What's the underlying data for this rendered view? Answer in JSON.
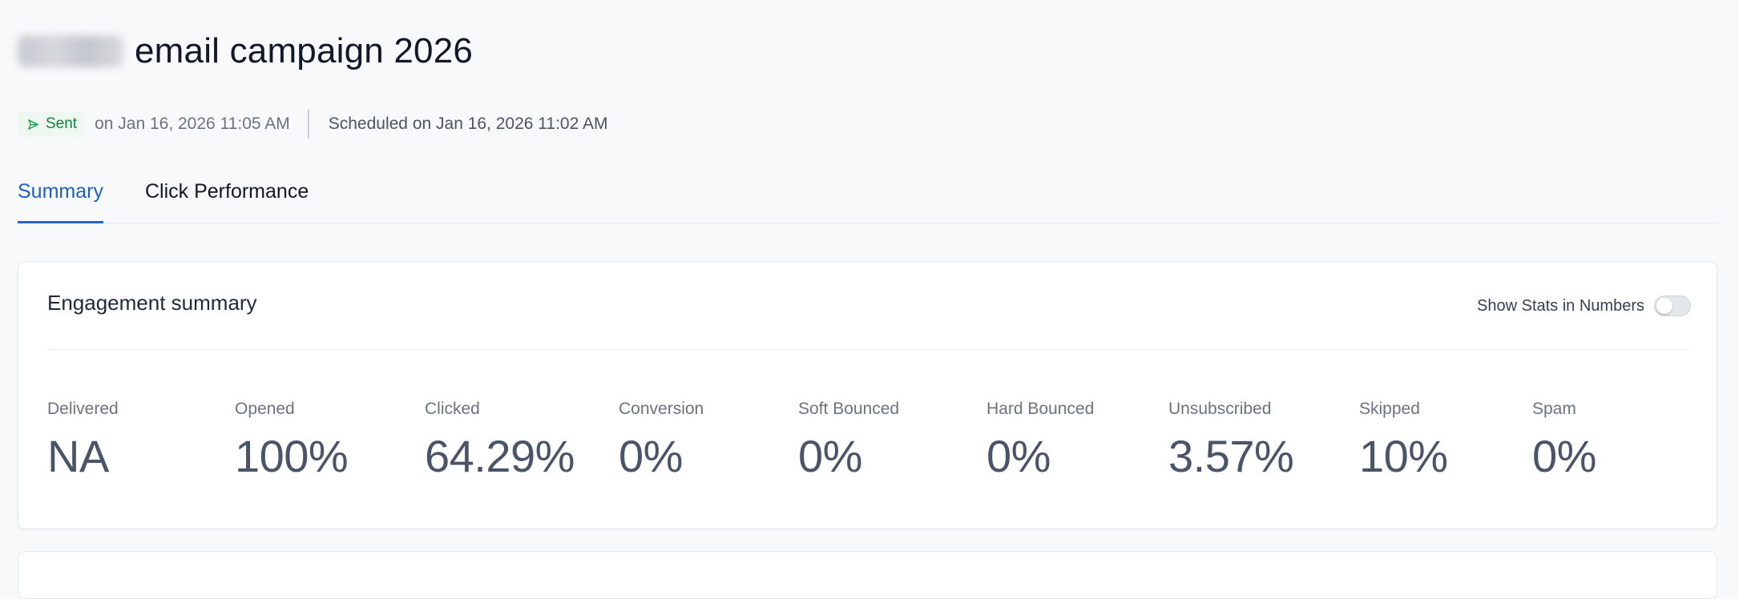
{
  "header": {
    "title": "email campaign 2026"
  },
  "status": {
    "badge_label": "Sent",
    "sent_text": "on Jan 16, 2026 11:05 AM",
    "scheduled_text": "Scheduled on Jan 16, 2026 11:02 AM",
    "colors": {
      "badge_text": "#15803d",
      "badge_bg": "#eef8f0"
    }
  },
  "tabs": [
    {
      "label": "Summary",
      "active": true
    },
    {
      "label": "Click Performance",
      "active": false
    }
  ],
  "engagement": {
    "title": "Engagement summary",
    "toggle_label": "Show Stats in Numbers",
    "toggle_on": false,
    "stats": [
      {
        "label": "Delivered",
        "value": "NA"
      },
      {
        "label": "Opened",
        "value": "100%"
      },
      {
        "label": "Clicked",
        "value": "64.29%"
      },
      {
        "label": "Conversion",
        "value": "0%"
      },
      {
        "label": "Soft Bounced",
        "value": "0%"
      },
      {
        "label": "Hard Bounced",
        "value": "0%"
      },
      {
        "label": "Unsubscribed",
        "value": "3.57%"
      },
      {
        "label": "Skipped",
        "value": "10%"
      },
      {
        "label": "Spam",
        "value": "0%"
      }
    ]
  },
  "theme": {
    "accent": "#2563c8"
  }
}
